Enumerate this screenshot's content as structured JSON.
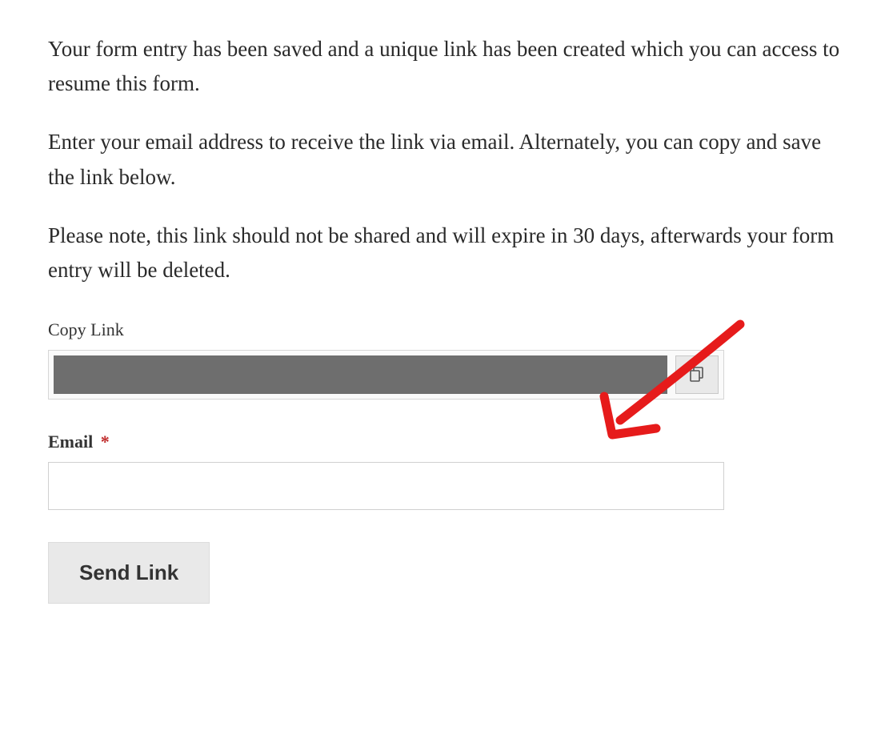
{
  "intro": {
    "paragraph1": "Your form entry has been saved and a unique link has been created which you can access to resume this form.",
    "paragraph2": "Enter your email address to receive the link via email. Alternately, you can copy and save the link below.",
    "paragraph3": "Please note, this link should not be shared and will expire in 30 days, afterwards your form entry will be deleted."
  },
  "copyLink": {
    "label": "Copy Link",
    "value": ""
  },
  "email": {
    "label": "Email",
    "requiredMark": "*",
    "value": ""
  },
  "submit": {
    "label": "Send Link"
  }
}
